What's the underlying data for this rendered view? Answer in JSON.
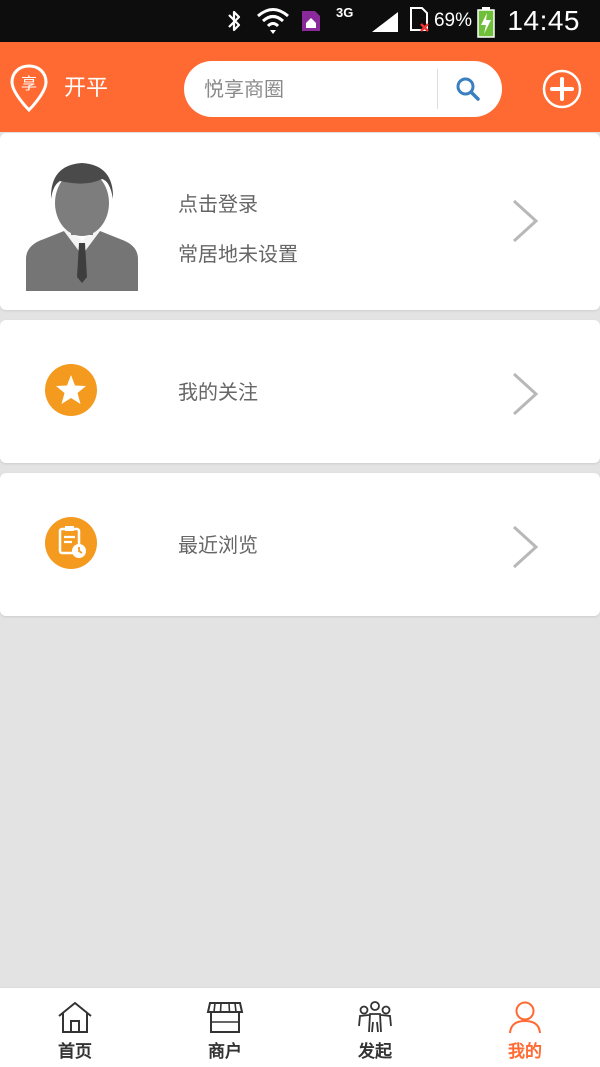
{
  "status_bar": {
    "network": "3G",
    "battery": "69%",
    "time": "14:45"
  },
  "header": {
    "logo_char": "享",
    "city": "开平",
    "search_placeholder": "悦享商圈"
  },
  "profile_card": {
    "login_label": "点击登录",
    "residence_label": "常居地未设置"
  },
  "menu": {
    "follow_label": "我的关注",
    "recent_label": "最近浏览"
  },
  "bottom_nav": {
    "tabs": [
      {
        "label": "首页",
        "icon": "home-icon",
        "active": false
      },
      {
        "label": "商户",
        "icon": "store-icon",
        "active": false
      },
      {
        "label": "发起",
        "icon": "group-icon",
        "active": false
      },
      {
        "label": "我的",
        "icon": "user-icon",
        "active": true
      }
    ]
  },
  "colors": {
    "accent": "#ff6a33",
    "status_bar": "#0d0d0d",
    "background": "#e3e3e3",
    "icon_orange": "#f39a1f"
  }
}
